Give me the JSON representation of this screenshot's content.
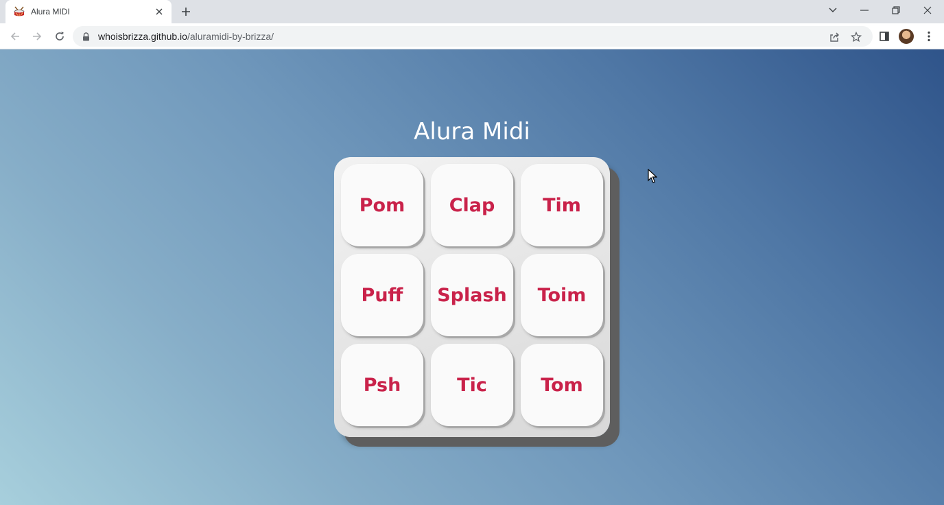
{
  "browser": {
    "tab_title": "Alura MIDI",
    "url_host": "whoisbrizza.github.io",
    "url_path": "/aluramidi-by-brizza/",
    "icons": {
      "favicon": "drum-icon",
      "tab_close": "close-icon",
      "new_tab": "plus-icon",
      "tab_search": "chevron-down-icon",
      "minimize": "minimize-icon",
      "restore": "restore-icon",
      "close_window": "close-icon",
      "back": "back-arrow-icon",
      "forward": "forward-arrow-icon",
      "reload": "reload-icon",
      "lock": "lock-icon",
      "share": "share-icon",
      "bookmark": "star-icon",
      "side_panel": "side-panel-icon",
      "profile": "avatar",
      "menu": "kebab-menu-icon"
    }
  },
  "page": {
    "title": "Alura Midi",
    "pads": [
      {
        "label": "Pom"
      },
      {
        "label": "Clap"
      },
      {
        "label": "Tim"
      },
      {
        "label": "Puff"
      },
      {
        "label": "Splash"
      },
      {
        "label": "Toim"
      },
      {
        "label": "Psh"
      },
      {
        "label": "Tic"
      },
      {
        "label": "Tom"
      }
    ],
    "colors": {
      "pad_text": "#c9224a",
      "pad_background": "#fafafa",
      "board": "#e6e6e6",
      "background_start": "#a7cfdc",
      "background_end": "#2f548a"
    }
  }
}
